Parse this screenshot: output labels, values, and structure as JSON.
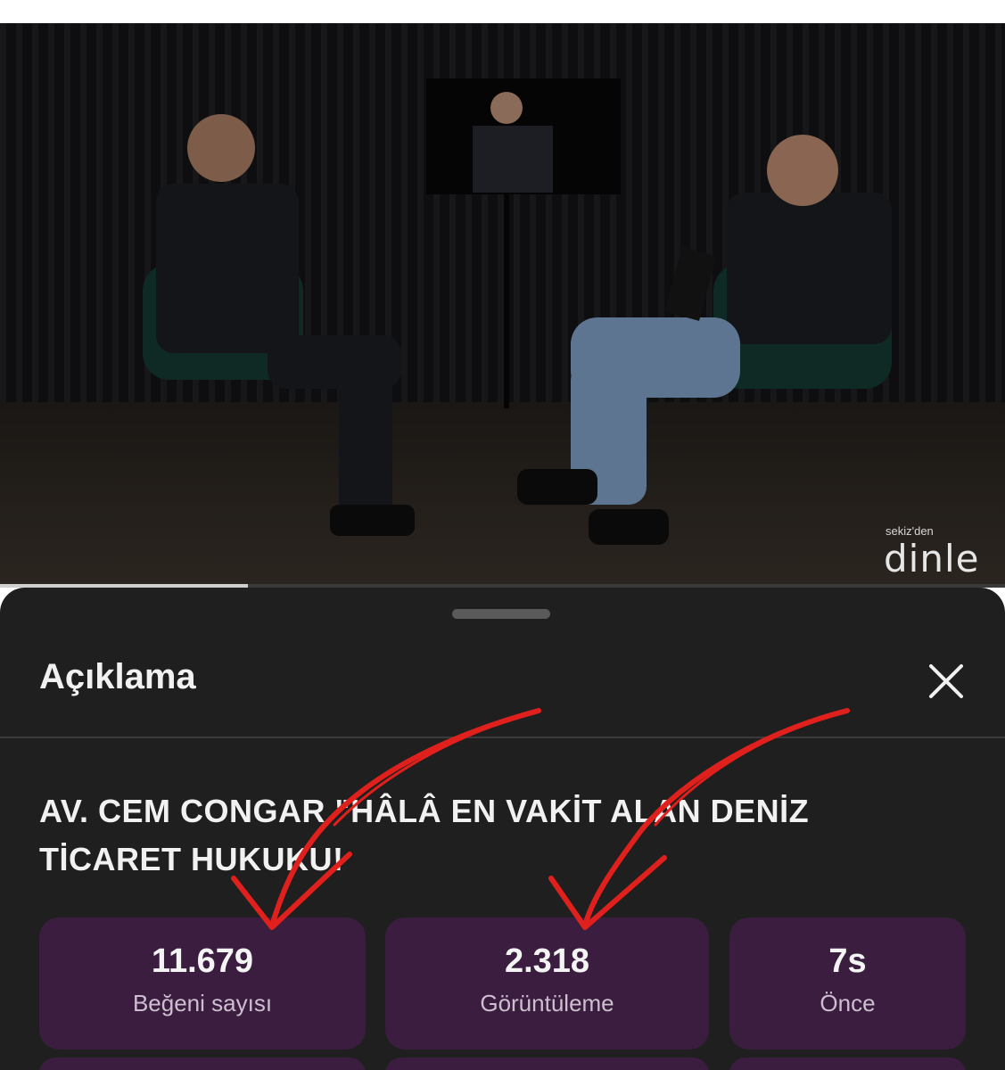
{
  "video": {
    "watermark_small": "sekiz'den",
    "watermark_big": "dinle",
    "progress": 0.247
  },
  "sheet": {
    "title": "Açıklama",
    "video_title_line1": "AV. CEM CONGAR \"HÂLÂ EN VAKİT ALAN DENİZ",
    "video_title_line2": "TİCARET HUKUKU!",
    "stats": [
      {
        "value": "11.679",
        "label": "Beğeni sayısı"
      },
      {
        "value": "2.318",
        "label": "Görüntüleme"
      },
      {
        "value": "7s",
        "label": "Önce"
      }
    ]
  },
  "colors": {
    "sheet_bg": "#1f1f1f",
    "stat_bg": "#3a1d3f",
    "annotation_arrow": "#e0201c"
  },
  "icons": [
    "close-icon"
  ]
}
